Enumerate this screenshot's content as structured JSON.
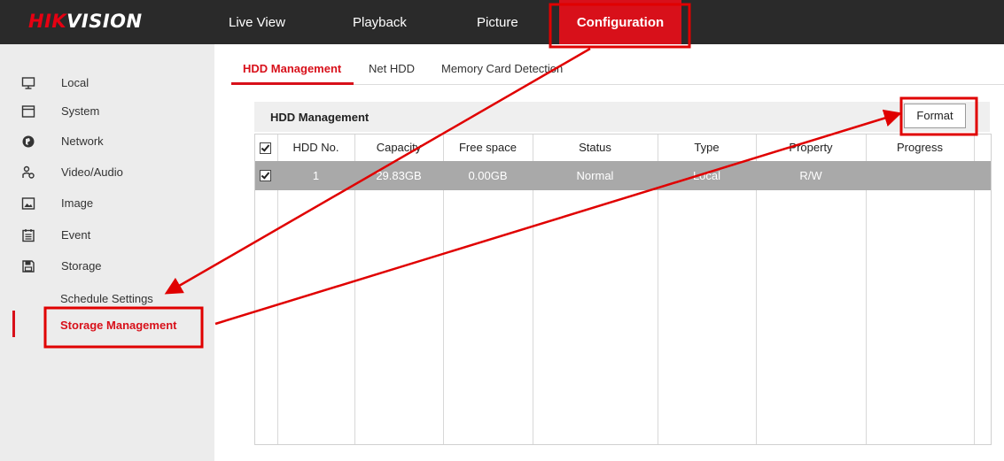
{
  "brand": {
    "logo_red": "HIK",
    "logo_white": "VISION"
  },
  "nav": {
    "items": [
      "Live View",
      "Playback",
      "Picture",
      "Configuration"
    ],
    "active": "Configuration"
  },
  "sidebar": {
    "items": [
      {
        "label": "Local",
        "icon": "monitor-icon"
      },
      {
        "label": "System",
        "icon": "window-icon"
      },
      {
        "label": "Network",
        "icon": "globe-icon"
      },
      {
        "label": "Video/Audio",
        "icon": "user-audio-icon"
      },
      {
        "label": "Image",
        "icon": "image-icon"
      },
      {
        "label": "Event",
        "icon": "calendar-icon"
      },
      {
        "label": "Storage",
        "icon": "floppy-icon"
      }
    ],
    "sub_items": [
      "Schedule Settings",
      "Storage Management"
    ],
    "active_sub": "Storage Management"
  },
  "tabs": {
    "items": [
      "HDD Management",
      "Net HDD",
      "Memory Card Detection"
    ],
    "active": "HDD Management"
  },
  "panel": {
    "title": "HDD Management",
    "format_label": "Format",
    "columns": [
      "HDD No.",
      "Capacity",
      "Free space",
      "Status",
      "Type",
      "Property",
      "Progress"
    ],
    "rows": [
      {
        "hdd_no": "1",
        "capacity": "29.83GB",
        "free_space": "0.00GB",
        "status": "Normal",
        "type": "Local",
        "property": "R/W",
        "progress": ""
      }
    ]
  },
  "colors": {
    "accent": "#d8101a",
    "topbar": "#2a2a2a",
    "sidebar": "#ececec",
    "row_selected": "#a9a9a9"
  }
}
